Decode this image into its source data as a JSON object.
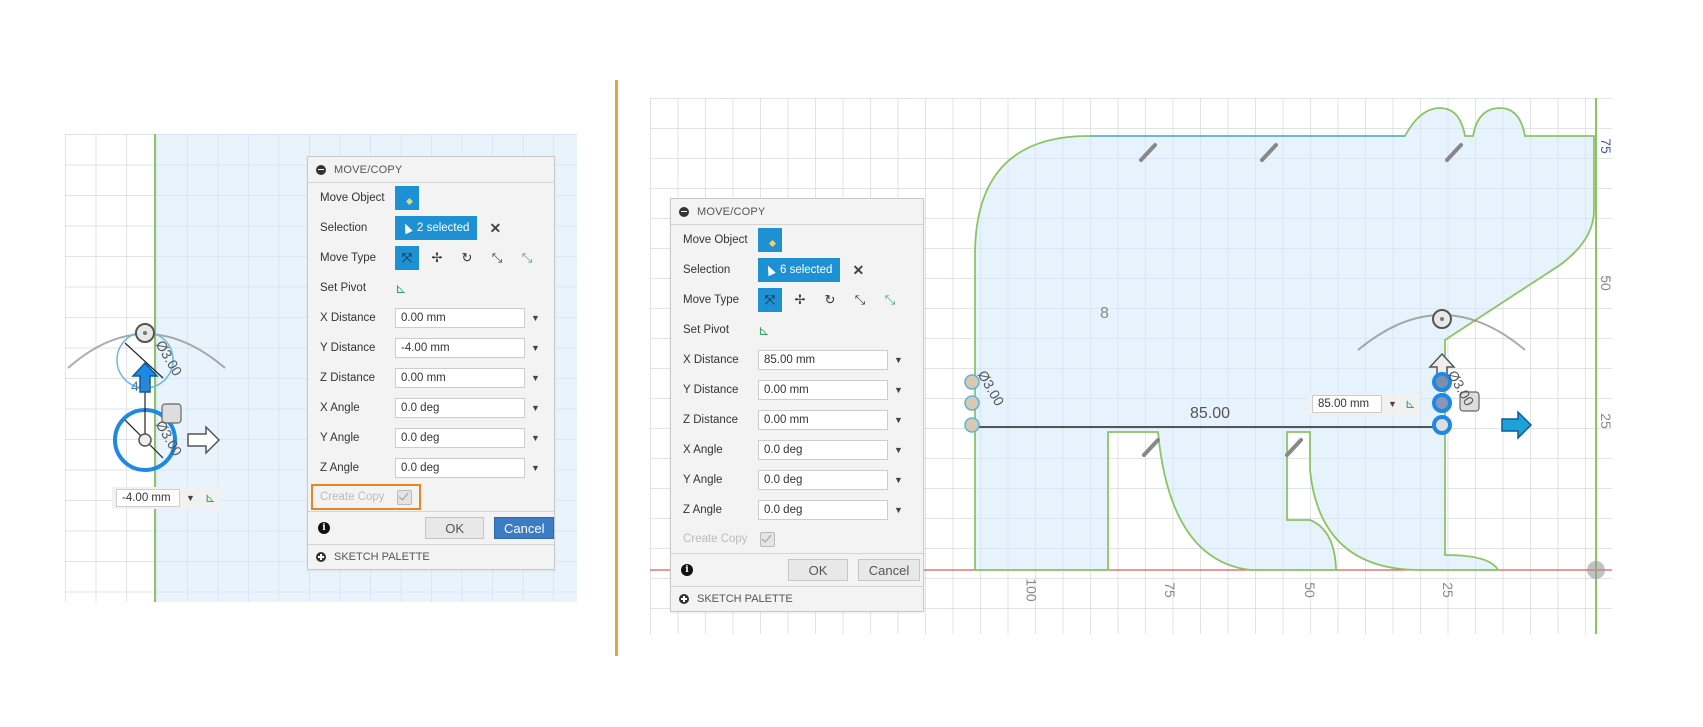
{
  "left": {
    "dialog": {
      "title": "MOVE/COPY",
      "move_object_label": "Move Object",
      "selection_label": "Selection",
      "selection_value": "2 selected",
      "move_type_label": "Move Type",
      "set_pivot_label": "Set Pivot",
      "fields": [
        {
          "label": "X Distance",
          "value": "0.00 mm"
        },
        {
          "label": "Y Distance",
          "value": "-4.00 mm"
        },
        {
          "label": "Z Distance",
          "value": "0.00 mm"
        },
        {
          "label": "X Angle",
          "value": "0.0 deg"
        },
        {
          "label": "Y Angle",
          "value": "0.0 deg"
        },
        {
          "label": "Z Angle",
          "value": "0.0 deg"
        }
      ],
      "create_copy_label": "Create Copy",
      "create_copy_checked": true,
      "ok_label": "OK",
      "cancel_label": "Cancel",
      "palette_label": "SKETCH PALETTE"
    },
    "canvas": {
      "floating_value": "-4.00 mm",
      "dim_diameter": "Ø3.00",
      "dim_partial": "4.0"
    }
  },
  "right": {
    "dialog": {
      "title": "MOVE/COPY",
      "move_object_label": "Move Object",
      "selection_label": "Selection",
      "selection_value": "6 selected",
      "move_type_label": "Move Type",
      "set_pivot_label": "Set Pivot",
      "fields": [
        {
          "label": "X Distance",
          "value": "85.00 mm"
        },
        {
          "label": "Y Distance",
          "value": "0.00 mm"
        },
        {
          "label": "Z Distance",
          "value": "0.00 mm"
        },
        {
          "label": "X Angle",
          "value": "0.0 deg"
        },
        {
          "label": "Y Angle",
          "value": "0.0 deg"
        },
        {
          "label": "Z Angle",
          "value": "0.0 deg"
        }
      ],
      "create_copy_label": "Create Copy",
      "create_copy_checked": true,
      "ok_label": "OK",
      "cancel_label": "Cancel",
      "palette_label": "SKETCH PALETTE"
    },
    "canvas": {
      "floating_value": "85.00 mm",
      "dimension_label": "85.00",
      "dim_diameter": "Ø3.00",
      "x_axis_ticks": [
        "100",
        "75",
        "50",
        "25"
      ],
      "y_axis_ticks": [
        "75",
        "50",
        "25"
      ],
      "fillet_marker": "8"
    }
  },
  "colors": {
    "accent_blue": "#1e90d4",
    "highlight_orange": "#e8861f",
    "sketch_green": "#8cc464",
    "axis_red": "#e05a5a",
    "primary_button": "#3b7cc4"
  }
}
